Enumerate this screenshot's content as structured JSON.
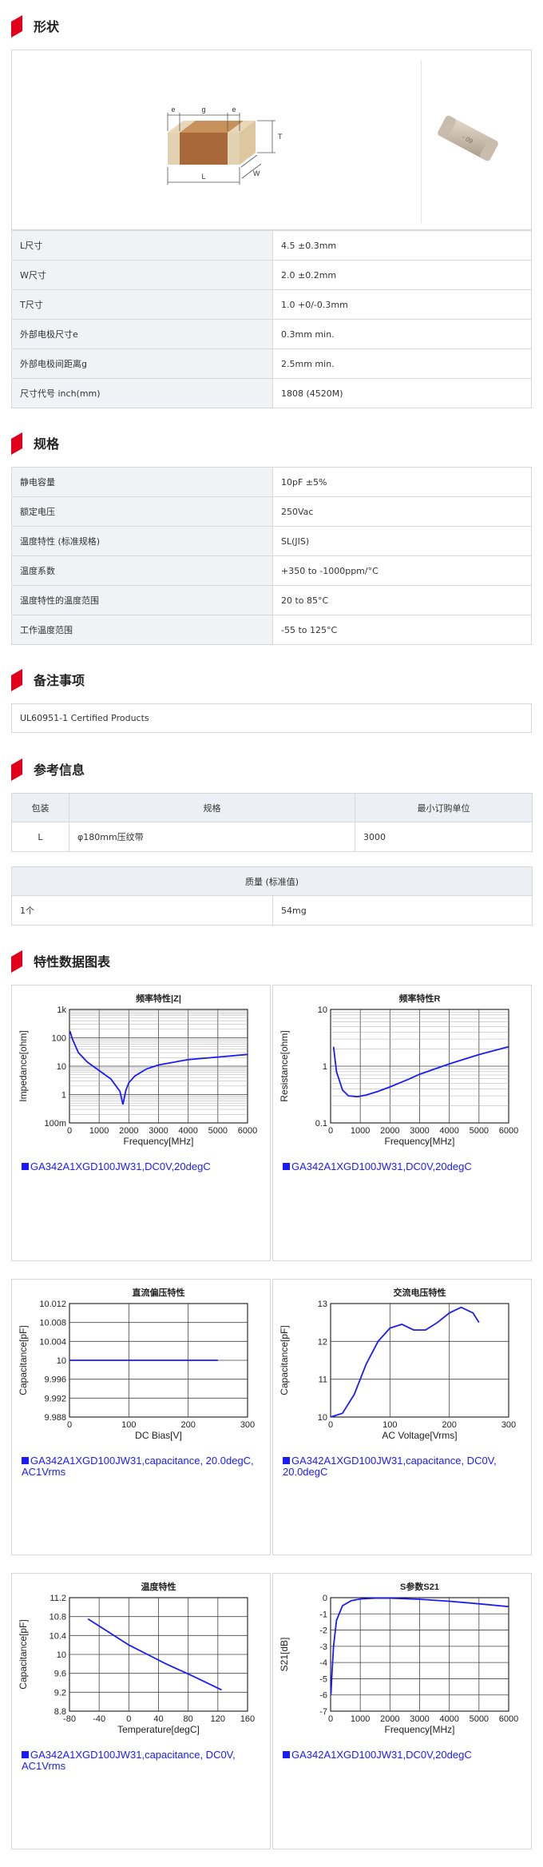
{
  "sections": {
    "shape": "形状",
    "spec": "规格",
    "notes": "备注事项",
    "reference": "参考信息",
    "charts": "特性数据图表"
  },
  "dimension_labels": {
    "e": "e",
    "g": "g",
    "T": "T",
    "L": "L",
    "W": "W"
  },
  "shape_rows": [
    {
      "k": "L尺寸",
      "v": "4.5 ±0.3mm"
    },
    {
      "k": "W尺寸",
      "v": "2.0 ±0.2mm"
    },
    {
      "k": "T尺寸",
      "v": "1.0 +0/-0.3mm"
    },
    {
      "k": "外部电极尺寸e",
      "v": "0.3mm min."
    },
    {
      "k": "外部电极间距离g",
      "v": "2.5mm min."
    },
    {
      "k": "尺寸代号 inch(mm)",
      "v": "1808 (4520M)"
    }
  ],
  "spec_rows": [
    {
      "k": "静电容量",
      "v": "10pF ±5%"
    },
    {
      "k": "额定电压",
      "v": "250Vac"
    },
    {
      "k": "温度特性 (标准规格)",
      "v": "SL(JIS)"
    },
    {
      "k": "温度系数",
      "v": "+350 to -1000ppm/°C"
    },
    {
      "k": "温度特性的温度范围",
      "v": "20 to 85°C"
    },
    {
      "k": "工作温度范围",
      "v": "-55 to 125°C"
    }
  ],
  "notes_text": "UL60951-1 Certified Products",
  "packaging": {
    "headers": [
      "包装",
      "规格",
      "最小订购单位"
    ],
    "row": [
      "L",
      "φ180mm压纹带",
      "3000"
    ]
  },
  "mass": {
    "header": "质量 (标准值)",
    "row": [
      "1个",
      "54mg"
    ]
  },
  "colors": {
    "accent": "#e0001a",
    "curve": "#1a1aff",
    "key_bg": "#f0f2f5"
  },
  "chart_data": [
    {
      "type": "line",
      "title": "频率特性|Z|",
      "xlabel": "Frequency[MHz]",
      "ylabel": "Impedance[ohm]",
      "xlim": [
        0,
        6000
      ],
      "ylim_log": [
        0.1,
        1000
      ],
      "xticks": [
        "0",
        "1000",
        "2000",
        "3000",
        "4000",
        "5000",
        "6000"
      ],
      "yticks": [
        "1k",
        "100",
        "10",
        "1",
        "100m"
      ],
      "log_y": true,
      "x": [
        20,
        100,
        300,
        600,
        1000,
        1400,
        1700,
        1800,
        1850,
        1900,
        2000,
        2200,
        2600,
        3000,
        4000,
        5000,
        6000
      ],
      "y": [
        170,
        90,
        30,
        14,
        7,
        3.5,
        1.3,
        0.45,
        0.8,
        1.4,
        2.6,
        4.5,
        8,
        11,
        17,
        21,
        26
      ],
      "legend": "GA342A1XGD100JW31,DC0V,20degC"
    },
    {
      "type": "line",
      "title": "频率特性R",
      "xlabel": "Frequency[MHz]",
      "ylabel": "Resistance[ohm]",
      "xlim": [
        0,
        6000
      ],
      "ylim_log": [
        0.1,
        10
      ],
      "xticks": [
        "0",
        "1000",
        "2000",
        "3000",
        "4000",
        "5000",
        "6000"
      ],
      "yticks": [
        "10",
        "1",
        "0.1"
      ],
      "log_y": true,
      "x": [
        100,
        200,
        400,
        600,
        900,
        1200,
        1600,
        2000,
        2600,
        3000,
        4000,
        5000,
        6000
      ],
      "y": [
        2.2,
        0.8,
        0.38,
        0.3,
        0.29,
        0.31,
        0.36,
        0.43,
        0.58,
        0.72,
        1.1,
        1.6,
        2.2
      ],
      "legend": "GA342A1XGD100JW31,DC0V,20degC"
    },
    {
      "type": "line",
      "title": "直流偏压特性",
      "xlabel": "DC Bias[V]",
      "ylabel": "Capacitance[pF]",
      "xlim": [
        0,
        300
      ],
      "ylim": [
        9.988,
        10.012
      ],
      "xticks": [
        "0",
        "100",
        "200",
        "300"
      ],
      "yticks": [
        "10.012",
        "10.008",
        "10.004",
        "10",
        "9.996",
        "9.992",
        "9.988"
      ],
      "x": [
        0,
        250
      ],
      "y": [
        10,
        10
      ],
      "legend": "GA342A1XGD100JW31,capacitance, 20.0degC, AC1Vrms"
    },
    {
      "type": "line",
      "title": "交流电压特性",
      "xlabel": "AC Voltage[Vrms]",
      "ylabel": "Capacitance[pF]",
      "xlim": [
        0,
        300
      ],
      "ylim": [
        10,
        13
      ],
      "xticks": [
        "0",
        "100",
        "200",
        "300"
      ],
      "yticks": [
        "13",
        "12",
        "11",
        "10"
      ],
      "x": [
        0,
        20,
        40,
        60,
        80,
        100,
        120,
        140,
        160,
        180,
        200,
        220,
        240,
        250
      ],
      "y": [
        10,
        10.1,
        10.6,
        11.4,
        12.0,
        12.35,
        12.45,
        12.3,
        12.3,
        12.5,
        12.75,
        12.9,
        12.75,
        12.5
      ],
      "legend": "GA342A1XGD100JW31,capacitance, DC0V, 20.0degC"
    },
    {
      "type": "line",
      "title": "温度特性",
      "xlabel": "Temperature[degC]",
      "ylabel": "Capacitance[pF]",
      "xlim": [
        -80,
        160
      ],
      "ylim": [
        8.8,
        11.2
      ],
      "xticks": [
        "-80",
        "-40",
        "0",
        "40",
        "80",
        "120",
        "160"
      ],
      "yticks": [
        "11.2",
        "10.8",
        "10.4",
        "10",
        "9.6",
        "9.2",
        "8.8"
      ],
      "x": [
        -55,
        -25,
        0,
        25,
        50,
        85,
        125
      ],
      "y": [
        10.75,
        10.45,
        10.2,
        10.0,
        9.8,
        9.55,
        9.25
      ],
      "legend": "GA342A1XGD100JW31,capacitance, DC0V, AC1Vrms"
    },
    {
      "type": "line",
      "title": "S参数S21",
      "xlabel": "Frequency[MHz]",
      "ylabel": "S21[dB]",
      "xlim": [
        0,
        6000
      ],
      "ylim": [
        -7,
        0
      ],
      "xticks": [
        "0",
        "1000",
        "2000",
        "3000",
        "4000",
        "5000",
        "6000"
      ],
      "yticks": [
        "0",
        "-1",
        "-2",
        "-3",
        "-4",
        "-5",
        "-6",
        "-7"
      ],
      "x": [
        10,
        50,
        100,
        200,
        400,
        700,
        1000,
        1500,
        2000,
        3000,
        4000,
        5000,
        6000
      ],
      "y": [
        -6,
        -4.5,
        -3,
        -1.4,
        -0.5,
        -0.18,
        -0.08,
        -0.03,
        -0.03,
        -0.1,
        -0.22,
        -0.38,
        -0.55
      ],
      "legend": "GA342A1XGD100JW31,DC0V,20degC"
    }
  ]
}
